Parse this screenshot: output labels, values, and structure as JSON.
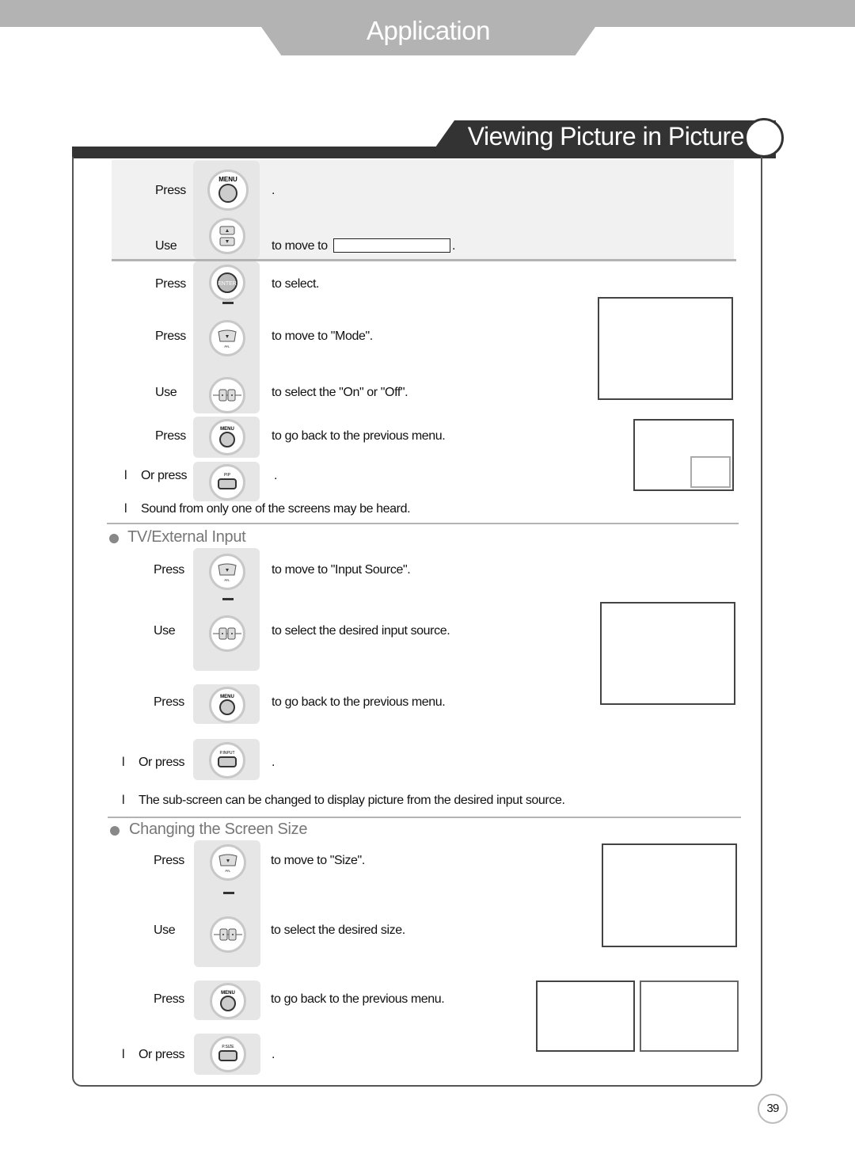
{
  "header": {
    "category": "Application",
    "section_title": "Viewing Picture in Picture"
  },
  "pip_mode": {
    "steps": [
      {
        "verb": "Press",
        "button": "MENU",
        "text": "."
      },
      {
        "verb": "Use",
        "button": "UP/DOWN",
        "text": "to move to",
        "trailing": "."
      },
      {
        "verb": "Press",
        "button": "ENTER",
        "text": "to select."
      },
      {
        "verb": "Press",
        "button": "DOWN",
        "text": "to move to \"Mode\"."
      },
      {
        "verb": "Use",
        "button": "LEFT/RIGHT",
        "text": "to select the \"On\" or \"Off\"."
      },
      {
        "verb": "Press",
        "button": "MENU",
        "text": "to go back to the previous menu."
      }
    ],
    "or_press": {
      "bullet": "l",
      "verb": "Or press",
      "button": "PIP",
      "text": "."
    },
    "note": {
      "bullet": "l",
      "text": "Sound from only one of the screens may be heard."
    }
  },
  "tv_external_input": {
    "title": "TV/External Input",
    "steps": [
      {
        "verb": "Press",
        "button": "DOWN",
        "text": "to move to \"Input Source\"."
      },
      {
        "verb": "Use",
        "button": "LEFT/RIGHT",
        "text": "to select the desired input source."
      },
      {
        "verb": "Press",
        "button": "MENU",
        "text": "to go back to the previous menu."
      }
    ],
    "or_press": {
      "bullet": "l",
      "verb": "Or press",
      "button": "P.INPUT",
      "text": "."
    },
    "note": {
      "bullet": "l",
      "text": "The sub-screen can be changed to display picture from the desired input source."
    }
  },
  "screen_size": {
    "title": "Changing the Screen Size",
    "steps": [
      {
        "verb": "Press",
        "button": "DOWN",
        "text": "to move to \"Size\"."
      },
      {
        "verb": "Use",
        "button": "LEFT/RIGHT",
        "text": "to select the desired size."
      },
      {
        "verb": "Press",
        "button": "MENU",
        "text": "to go back to the previous menu."
      }
    ],
    "or_press": {
      "bullet": "l",
      "verb": "Or press",
      "button": "P.SIZE",
      "text": "."
    }
  },
  "button_labels": {
    "menu": "MENU",
    "enter": "ENTER",
    "pip": "PIP",
    "pinput": "P.INPUT",
    "psize": "P.SIZE"
  },
  "page_number": "39"
}
